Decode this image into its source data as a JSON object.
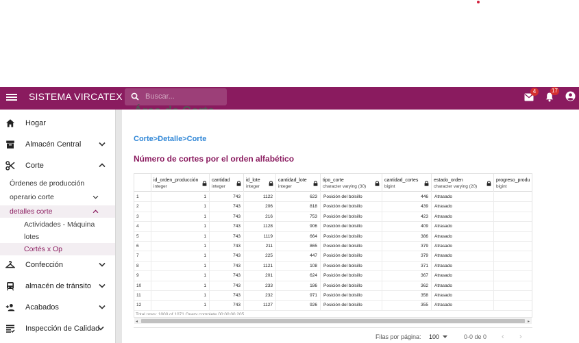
{
  "appbar": {
    "title": "SISTEMA VIRCATEX",
    "search_placeholder": "Buscar...",
    "mail_count": "4",
    "notif_count": "17",
    "brand_color": "#8a1b5f"
  },
  "sidebar": {
    "items": [
      {
        "label": "Hogar",
        "icon": "home-icon"
      },
      {
        "label": "Almacén Central",
        "icon": "archive-icon"
      },
      {
        "label": "Corte",
        "icon": "scissors-icon"
      },
      {
        "label": "Confección",
        "icon": "hanger-icon"
      },
      {
        "label": "almacén de tránsito",
        "icon": "train-icon"
      },
      {
        "label": "Acabados",
        "icon": "person-add-icon"
      },
      {
        "label": "Inspección de Calidad",
        "icon": "list-check-icon"
      }
    ],
    "corte_sub": [
      {
        "label": "Órdenes de producción"
      },
      {
        "label": "operario corte"
      },
      {
        "label": "detalles corte"
      }
    ],
    "detalles_sub": [
      {
        "label_line1": "Actividades - Máquina",
        "label_line2": "lotes"
      },
      {
        "label": "Cortés x Op"
      }
    ]
  },
  "main": {
    "ghost_title": "Área de Corte",
    "breadcrumb": "Corte>Detalle>Corte",
    "heading": "Número de cortes por el orden alfabético"
  },
  "grid": {
    "columns": [
      {
        "name": "id_orden_producción",
        "type": "integer"
      },
      {
        "name": "cantidad",
        "type": "integer"
      },
      {
        "name": "id_lote",
        "type": "integer"
      },
      {
        "name": "cantidad_lote",
        "type": "integer"
      },
      {
        "name": "tipo_corte",
        "type": "character varying (30)"
      },
      {
        "name": "cantidad_cortes",
        "type": "bigint"
      },
      {
        "name": "estado_orden",
        "type": "character varying (20)"
      },
      {
        "name": "progreso_produ",
        "type": "bigint"
      }
    ],
    "rows": [
      [
        "1",
        "1",
        "743",
        "1122",
        "623",
        "Posición del bolsillo",
        "446",
        "Atrasado"
      ],
      [
        "2",
        "1",
        "743",
        "206",
        "818",
        "Posición del bolsillo",
        "439",
        "Atrasado"
      ],
      [
        "3",
        "1",
        "743",
        "216",
        "753",
        "Posición del bolsillo",
        "423",
        "Atrasado"
      ],
      [
        "4",
        "1",
        "743",
        "1128",
        "906",
        "Posición del bolsillo",
        "409",
        "Atrasado"
      ],
      [
        "5",
        "1",
        "743",
        "1119",
        "664",
        "Posición del bolsillo",
        "386",
        "Atrasado"
      ],
      [
        "6",
        "1",
        "743",
        "211",
        "865",
        "Posición del bolsillo",
        "379",
        "Atrasado"
      ],
      [
        "7",
        "1",
        "743",
        "225",
        "447",
        "Posición del bolsillo",
        "379",
        "Atrasado"
      ],
      [
        "8",
        "1",
        "743",
        "1121",
        "108",
        "Posición del bolsillo",
        "371",
        "Atrasado"
      ],
      [
        "9",
        "1",
        "743",
        "201",
        "624",
        "Posición del bolsillo",
        "367",
        "Atrasado"
      ],
      [
        "10",
        "1",
        "743",
        "233",
        "186",
        "Posición del bolsillo",
        "362",
        "Atrasado"
      ],
      [
        "11",
        "1",
        "743",
        "232",
        "971",
        "Posición del bolsillo",
        "358",
        "Atrasado"
      ],
      [
        "12",
        "1",
        "743",
        "1127",
        "926",
        "Posición del bolsillo",
        "355",
        "Atrasado"
      ]
    ],
    "footer_text": "Total rows: 1000 of 1071   Query complete 00:00:00.205"
  },
  "pager": {
    "rows_per_page_label": "Filas por página:",
    "rows_per_page_value": "100",
    "range": "0-0 de 0",
    "prev": "‹",
    "next": "›"
  }
}
